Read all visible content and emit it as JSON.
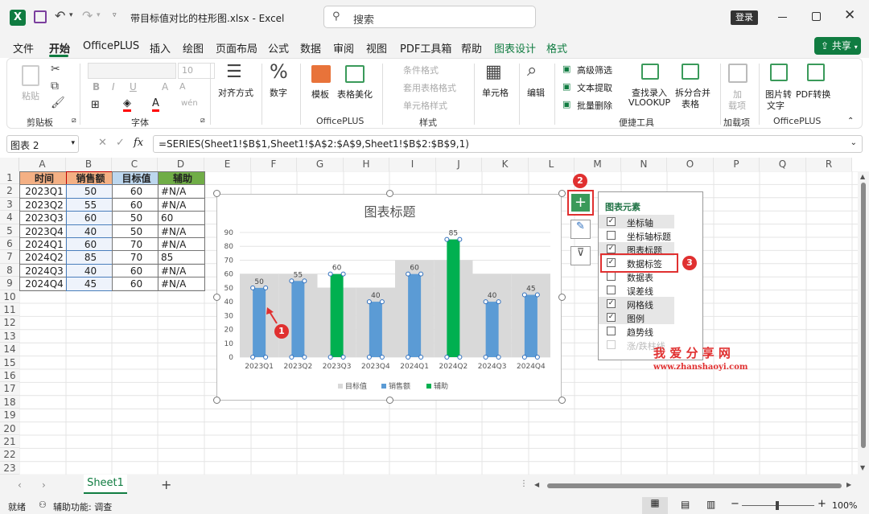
{
  "titlebar": {
    "filename": "带目标值对比的柱形图.xlsx",
    "app": "Excel",
    "search_placeholder": "搜索",
    "login_label": "登录"
  },
  "menu": {
    "items": [
      "文件",
      "开始",
      "OfficePLUS",
      "插入",
      "绘图",
      "页面布局",
      "公式",
      "数据",
      "审阅",
      "视图",
      "PDF工具箱",
      "帮助",
      "图表设计",
      "格式"
    ],
    "share_label": "共享"
  },
  "ribbon": {
    "clipboard": {
      "paste": "粘贴",
      "label": "剪贴板"
    },
    "font": {
      "label": "字体",
      "size": "10"
    },
    "align": {
      "label": "对齐方式"
    },
    "number": {
      "label": "数字"
    },
    "officeplus": {
      "template": "模板",
      "beautify": "表格美化",
      "label": "OfficePLUS"
    },
    "styles": {
      "cond": "条件格式",
      "table": "套用表格格式",
      "cell": "单元格样式",
      "label": "样式"
    },
    "cells": {
      "label": "单元格"
    },
    "edit": {
      "label": "编辑"
    },
    "tools": {
      "adv_filter": "高级筛选",
      "text_extract": "文本提取",
      "batch_delete": "批量删除",
      "find_vlookup_1": "查找录入",
      "find_vlookup_2": "VLOOKUP",
      "split_merge_1": "拆分合并",
      "split_merge_2": "表格",
      "label": "便捷工具"
    },
    "addins": {
      "add_1": "加",
      "add_2": "载项",
      "label": "加载项"
    },
    "officeplus2": {
      "pic2text_1": "图片转",
      "pic2text_2": "文字",
      "pdf_convert": "PDF转换",
      "label": "OfficePLUS"
    }
  },
  "formula_bar": {
    "name_box": "图表 2",
    "fx": "fx",
    "formula": "=SERIES(Sheet1!$B$1,Sheet1!$A$2:$A$9,Sheet1!$B$2:$B$9,1)"
  },
  "columns": [
    "A",
    "B",
    "C",
    "D",
    "E",
    "F",
    "G",
    "H",
    "I",
    "J",
    "K",
    "L",
    "M",
    "N",
    "O",
    "P",
    "Q",
    "R"
  ],
  "rows": [
    "1",
    "2",
    "3",
    "4",
    "5",
    "6",
    "7",
    "8",
    "9",
    "10",
    "11",
    "12",
    "13",
    "14",
    "15",
    "16",
    "17",
    "18",
    "19",
    "20",
    "21",
    "22",
    "23"
  ],
  "table": {
    "headers": [
      "时间",
      "销售额",
      "目标值",
      "辅助"
    ],
    "rows": [
      [
        "2023Q1",
        "50",
        "60",
        "#N/A"
      ],
      [
        "2023Q2",
        "55",
        "60",
        "#N/A"
      ],
      [
        "2023Q3",
        "60",
        "50",
        "60"
      ],
      [
        "2023Q4",
        "40",
        "50",
        "#N/A"
      ],
      [
        "2024Q1",
        "60",
        "70",
        "#N/A"
      ],
      [
        "2024Q2",
        "85",
        "70",
        "85"
      ],
      [
        "2024Q3",
        "40",
        "60",
        "#N/A"
      ],
      [
        "2024Q4",
        "45",
        "60",
        "#N/A"
      ]
    ]
  },
  "chart_data": {
    "type": "bar",
    "title": "图表标题",
    "categories": [
      "2023Q1",
      "2023Q2",
      "2023Q3",
      "2023Q4",
      "2024Q1",
      "2024Q2",
      "2024Q3",
      "2024Q4"
    ],
    "series": [
      {
        "name": "目标值",
        "values": [
          60,
          60,
          50,
          50,
          70,
          70,
          60,
          60
        ],
        "color": "#d9d9d9"
      },
      {
        "name": "销售额",
        "values": [
          50,
          55,
          60,
          40,
          60,
          85,
          40,
          45
        ],
        "color": "#5b9bd5"
      },
      {
        "name": "辅助",
        "values": [
          null,
          null,
          60,
          null,
          null,
          85,
          null,
          null
        ],
        "color": "#00b050"
      }
    ],
    "data_labels": [
      "50",
      "55",
      "60",
      "40",
      "60",
      "85",
      "40",
      "45"
    ],
    "yticks": [
      "0",
      "10",
      "20",
      "30",
      "40",
      "50",
      "60",
      "70",
      "80",
      "90"
    ],
    "ylim": [
      0,
      90
    ],
    "legend_position": "bottom"
  },
  "chart_elements_panel": {
    "title": "图表元素",
    "items": [
      {
        "label": "坐标轴",
        "checked": true
      },
      {
        "label": "坐标轴标题",
        "checked": false
      },
      {
        "label": "图表标题",
        "checked": true
      },
      {
        "label": "数据标签",
        "checked": true
      },
      {
        "label": "数据表",
        "checked": false
      },
      {
        "label": "误差线",
        "checked": false
      },
      {
        "label": "网格线",
        "checked": true
      },
      {
        "label": "图例",
        "checked": true
      },
      {
        "label": "趋势线",
        "checked": false
      },
      {
        "label": "涨/跌柱线",
        "checked": false
      }
    ]
  },
  "annotations": {
    "step1": "1",
    "step2": "2",
    "step3": "3"
  },
  "watermark": {
    "title": "我 爱 分 享 网",
    "url": "www.zhanshaoyi.com"
  },
  "sheet_tab": "Sheet1",
  "status": {
    "ready": "就绪",
    "accessibility": "辅助功能: 调查",
    "zoom": "100%"
  },
  "colors": {
    "excel_green": "#107c41",
    "accent_red": "#e03030",
    "selection_green": "#217346"
  }
}
